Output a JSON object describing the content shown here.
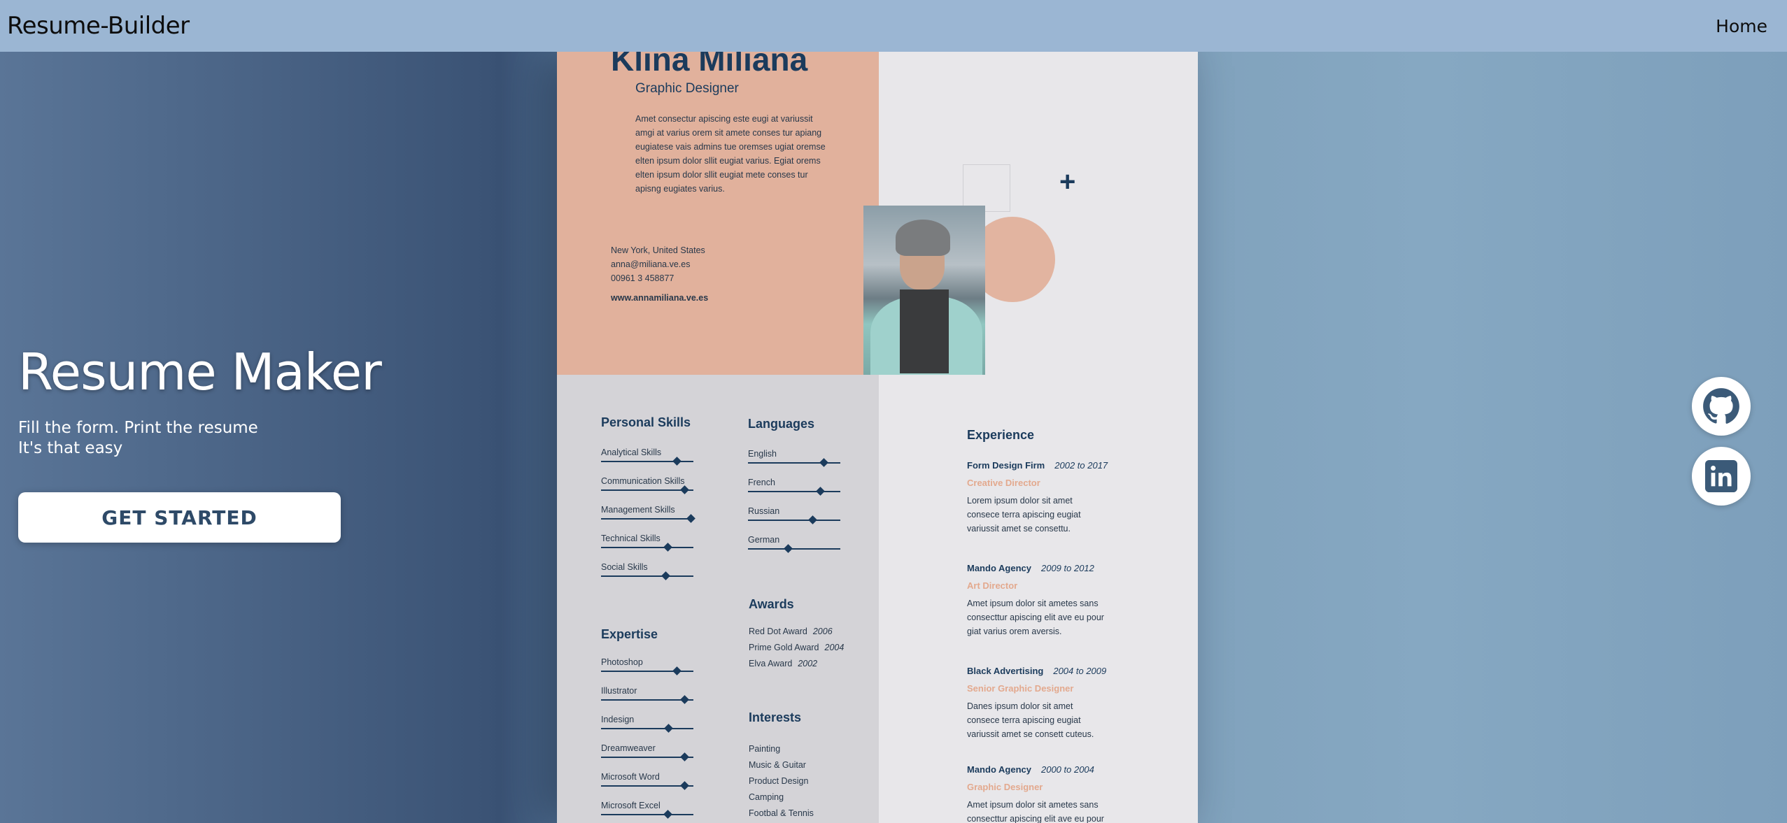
{
  "navbar": {
    "brand": "Resume-Builder",
    "home": "Home"
  },
  "hero": {
    "title": "Resume Maker",
    "subtitle_line1": "Fill the form. Print the resume",
    "subtitle_line2": "It's that easy",
    "cta": "GET STARTED"
  },
  "social": {
    "github_icon": "github-icon",
    "linkedin_icon": "linkedin-icon"
  },
  "resume": {
    "name": "Klina Miliana",
    "role": "Graphic Designer",
    "bio": "Amet consectur apiscing este eugi at variussit amgi at varius orem sit amete conses tur apiang eugiatese vais admins tue oremses ugiat oremse elten ipsum dolor sllit eugiat varius. Egiat orems elten ipsum dolor sllit eugiat mete conses tur apisng eugiates varius.",
    "location": "New York, United States",
    "email": "anna@miliana.ve.es",
    "phone": "00961 3 458877",
    "website": "www.annamiliana.ve.es",
    "personal_skills_title": "Personal Skills",
    "personal_skills": [
      {
        "label": "Analytical Skills",
        "level": 0.82
      },
      {
        "label": "Communication Skills",
        "level": 0.9
      },
      {
        "label": "Management Skills",
        "level": 0.97
      },
      {
        "label": "Technical Skills",
        "level": 0.72
      },
      {
        "label": "Social Skills",
        "level": 0.7
      }
    ],
    "languages_title": "Languages",
    "languages": [
      {
        "label": "English",
        "level": 0.82
      },
      {
        "label": "French",
        "level": 0.78
      },
      {
        "label": "Russian",
        "level": 0.7
      },
      {
        "label": "German",
        "level": 0.43
      }
    ],
    "expertise_title": "Expertise",
    "expertise": [
      {
        "label": "Photoshop",
        "level": 0.82
      },
      {
        "label": "Illustrator",
        "level": 0.9
      },
      {
        "label": "Indesign",
        "level": 0.73
      },
      {
        "label": "Dreamweaver",
        "level": 0.9
      },
      {
        "label": "Microsoft Word",
        "level": 0.9
      },
      {
        "label": "Microsoft Excel",
        "level": 0.72
      }
    ],
    "awards_title": "Awards",
    "awards": [
      {
        "name": "Red Dot Award",
        "year": "2006"
      },
      {
        "name": "Prime Gold Award",
        "year": "2004"
      },
      {
        "name": "Elva  Award",
        "year": "2002"
      }
    ],
    "interests_title": "Interests",
    "interests": [
      "Painting",
      "Music & Guitar",
      "Product Design",
      "Camping",
      "Footbal & Tennis"
    ],
    "experience_title": "Experience",
    "experience": [
      {
        "company": "Form Design Firm",
        "period": "2002 to 2017",
        "role": "Creative Director",
        "desc": "Lorem ipsum dolor sit amet consece terra apiscing eugiat variussit amet se consettu."
      },
      {
        "company": "Mando Agency",
        "period": "2009 to 2012",
        "role": "Art Director",
        "desc": "Amet ipsum dolor sit ametes sans consecttur apiscing elit ave eu pour giat varius orem aversis."
      },
      {
        "company": "Black Advertising",
        "period": "2004 to 2009",
        "role": "Senior Graphic Designer",
        "desc": "Danes ipsum dolor sit amet consece terra apiscing eugiat variussit amet se consett cuteus."
      },
      {
        "company": "Mando Agency",
        "period": "2000 to 2004",
        "role": "Graphic Designer",
        "desc": "Amet ipsum dolor sit ametes sans consecttur apiscing elit ave eu pour"
      }
    ]
  }
}
